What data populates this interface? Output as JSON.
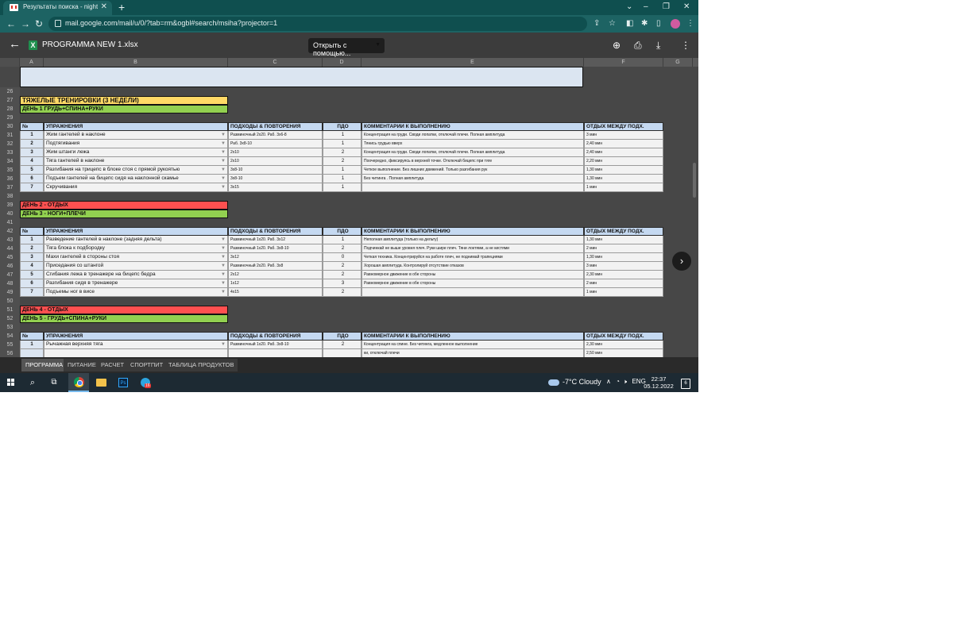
{
  "browser": {
    "tab_title": "Результаты поиска - nightcrawl",
    "new_tab": "+",
    "url": "mail.google.com/mail/u/0/?tab=rm&ogbl#search/msiha?projector=1",
    "window_buttons": [
      "‒",
      "❐",
      "✕"
    ]
  },
  "viewer": {
    "filename": "PROGRAMMA NEW 1.xlsx",
    "open_with": "Открыть с помощью...",
    "xl_letter": "X"
  },
  "columns": [
    "A",
    "B",
    "C",
    "D",
    "E",
    "F",
    "G"
  ],
  "rows": [
    {
      "n": "26",
      "kind": "blank"
    },
    {
      "n": "27",
      "kind": "title",
      "text": "ТЯЖЕЛЫЕ ТРЕНИРОВКИ (3 НЕДЕЛИ)",
      "color": "yellow"
    },
    {
      "n": "28",
      "kind": "title",
      "text": "ДЕНЬ 1 ГРУДЬ+СПИНА+РУКИ",
      "color": "green"
    },
    {
      "n": "29",
      "kind": "blank"
    },
    {
      "n": "30",
      "kind": "header"
    },
    {
      "n": "31",
      "kind": "data",
      "num": "1",
      "ex": "Жим гантелей в наклоне",
      "sets": "Разминочный 2х20. Раб. 3х6-8",
      "pdo": "1",
      "comment": "Концентрация на груди. Своди лопатки, отключай плечи. Полная амплитуда",
      "rest": "3 мин"
    },
    {
      "n": "32",
      "kind": "data",
      "num": "2",
      "ex": "Подтягивания",
      "sets": "Раб. 3х8-10",
      "pdo": "1",
      "comment": "Тянись грудью вверх",
      "rest": "2,40 мин"
    },
    {
      "n": "33",
      "kind": "data",
      "num": "3",
      "ex": "Жим штанги лежа",
      "sets": "2х10",
      "pdo": "2",
      "comment": "Концентрация на груди. Своди лопатки, отключай плечи. Полная амплитуда",
      "rest": "2,40  мин"
    },
    {
      "n": "34",
      "kind": "data",
      "num": "4",
      "ex": "Тяга гантелей в наклоне",
      "sets": "2х10",
      "pdo": "2",
      "comment": "Поочередно, фиксируясь в верхней точке. Отключай бицепс при тяге",
      "rest": "2,20 мин"
    },
    {
      "n": "35",
      "kind": "data",
      "num": "5",
      "ex": "Разгибания на трицепс в блоке стоя с прямой рукоятью",
      "sets": "3х8-10",
      "pdo": "1",
      "comment": "Четкое выполнение. Без лишних движений. Только разгибания рук",
      "rest": "1,30 мин"
    },
    {
      "n": "36",
      "kind": "data",
      "num": "6",
      "ex": "Подъем гантелей на бицепс сидя на наклонной скамье",
      "sets": "3х8-10",
      "pdo": "1",
      "comment": "Без читинга . Полная амплитуда",
      "rest": "1,30 мин"
    },
    {
      "n": "37",
      "kind": "data",
      "num": "7",
      "ex": "Скручивания",
      "sets": "3х15",
      "pdo": "1",
      "comment": "",
      "rest": "1 мин"
    },
    {
      "n": "38",
      "kind": "blank"
    },
    {
      "n": "39",
      "kind": "title",
      "text": "ДЕНЬ 2 - ОТДЫХ",
      "color": "red"
    },
    {
      "n": "40",
      "kind": "title",
      "text": "ДЕНЬ 3 - НОГИ+ПЛЕЧИ",
      "color": "green"
    },
    {
      "n": "41",
      "kind": "blank"
    },
    {
      "n": "42",
      "kind": "header"
    },
    {
      "n": "43",
      "kind": "data",
      "num": "1",
      "ex": "Разведение гантелей в наклоне (задняя дельта)",
      "sets": "Разминочный 1х20. Раб. 3х12",
      "pdo": "1",
      "comment": "Неполная амплитуда (только на дельту)",
      "rest": "1,30 мин"
    },
    {
      "n": "44",
      "kind": "data",
      "num": "2",
      "ex": "Тяга блока к подбородку",
      "sets": "Разминочный 1х20. Раб. 3х8-10",
      "pdo": "2",
      "comment": "Подчинкай не выше уровня плеч. Руки шире плеч. Тяни локтями, а не кистями",
      "rest": "2 мин"
    },
    {
      "n": "45",
      "kind": "data",
      "num": "3",
      "ex": "Махи гантелей в стороны стоя",
      "sets": "3х12",
      "pdo": "0",
      "comment": "Четкая техника. Концентрируйся на работе плеч, не поднимай трапециями",
      "rest": "1,30 мин"
    },
    {
      "n": "46",
      "kind": "data",
      "num": "4",
      "ex": "Приседания со штангой",
      "sets": "Разминочный 2х20. Раб. 3х8",
      "pdo": "2",
      "comment": "Хорошая амплитуда. Контролируй отсутствие отказов",
      "rest": "3 мин"
    },
    {
      "n": "47",
      "kind": "data",
      "num": "5",
      "ex": "Сгибания лежа в тренажере на бицепс бедра",
      "sets": "2х12",
      "pdo": "2",
      "comment": "Равномерное движение в обе стороны",
      "rest": "2,30 мин"
    },
    {
      "n": "48",
      "kind": "data",
      "num": "6",
      "ex": "Разгибания сидя в тренажере",
      "sets": "1х12",
      "pdo": "3",
      "comment": "Равномерное движение в обе стороны",
      "rest": "2 мин"
    },
    {
      "n": "49",
      "kind": "data",
      "num": "7",
      "ex": "Подъемы ног в висе",
      "sets": "4х15",
      "pdo": "2",
      "comment": "",
      "rest": "1 мин"
    },
    {
      "n": "50",
      "kind": "blank"
    },
    {
      "n": "51",
      "kind": "title",
      "text": "ДЕНЬ 4 - ОТДЫХ",
      "color": "red"
    },
    {
      "n": "52",
      "kind": "title",
      "text": "ДЕНЬ 5 - ГРУДЬ+СПИНА+РУКИ",
      "color": "green"
    },
    {
      "n": "53",
      "kind": "blank"
    },
    {
      "n": "54",
      "kind": "header"
    },
    {
      "n": "55",
      "kind": "data",
      "num": "1",
      "ex": "Рычажная верхняя тяга",
      "sets": "Разминочный 1х20. Раб. 3х8-10",
      "pdo": "2",
      "comment": "Концентрация на спине. Без читинга, медленное выполнение",
      "rest": "2,30 мин"
    },
    {
      "n": "56",
      "kind": "data",
      "num": "",
      "ex": "",
      "sets": "",
      "pdo": "",
      "comment": "ки, отключай плечи",
      "rest": "2,50 мин"
    }
  ],
  "table_header": {
    "num": "№",
    "exercises": "УПРАЖНЕНИЯ",
    "sets": "ПОДХОДЫ & ПОВТОРЕНИЯ",
    "pdo": "ПДО",
    "comments": "КОММЕНТАРИИ К ВЫПОЛНЕНИЮ",
    "rest": "ОТДЫХ МЕЖДУ ПОДХ."
  },
  "sheet_tabs": [
    "ПРОГРАММА",
    "ПИТАНИЕ",
    "РАСЧЕТ",
    "СПОРТПИТ",
    "ТАБЛИЦА ПРОДУКТОВ"
  ],
  "active_sheet": "ПРОГРАММА",
  "taskbar": {
    "weather": "-7°C  Cloudy",
    "lang": "ENG",
    "time": "22:37",
    "date": "05.12.2022",
    "notifications": "6",
    "telegram_badge": "16"
  },
  "colors": {
    "title_yellow": "#ffd966",
    "day_green": "#92d050",
    "rest_red": "#ff5050",
    "header_blue": "#c5d9f1"
  }
}
